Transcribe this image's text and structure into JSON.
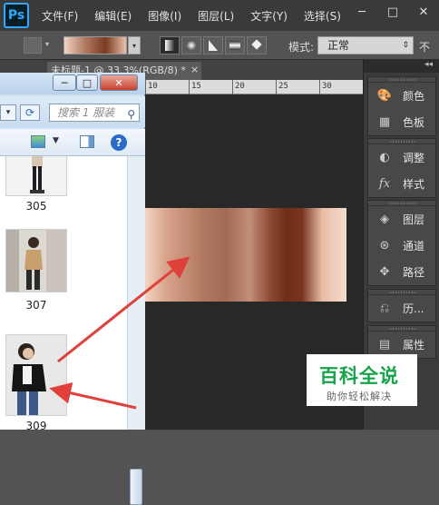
{
  "menubar": {
    "logo": "Ps",
    "items": [
      "文件(F)",
      "编辑(E)",
      "图像(I)",
      "图层(L)",
      "文字(Y)",
      "选择(S)"
    ]
  },
  "options_bar": {
    "gradient_colors": [
      "#f3d4c2",
      "#b07a62",
      "#7b3a22",
      "#e8c0aa"
    ],
    "mode_label": "模式:",
    "mode_value": "正常",
    "opacity_label_partial": "不"
  },
  "document_tab": {
    "title": "未标题-1 @ 33.3%(RGB/8) *",
    "close": "×"
  },
  "ruler": {
    "labels": [
      "10",
      "15",
      "20",
      "25",
      "30"
    ]
  },
  "panels": {
    "collapse": "◂◂",
    "group1": [
      "颜色",
      "色板"
    ],
    "group2": [
      "调整",
      "样式"
    ],
    "group3": [
      "图层",
      "通道",
      "路径"
    ],
    "group4": [
      "历..."
    ],
    "group5": [
      "属性"
    ]
  },
  "explorer": {
    "title_buttons": [
      "─",
      "□",
      "✕"
    ],
    "search_placeholder": "搜索 1 服装",
    "items": [
      {
        "label": "305"
      },
      {
        "label": "307"
      },
      {
        "label": "309"
      }
    ]
  },
  "watermark": {
    "title": "百科全说",
    "subtitle": "助你轻松解决"
  },
  "colors": {
    "accent_red": "#e0403a",
    "ps_blue": "#31a8ff",
    "watermark_green": "#16a34a"
  }
}
